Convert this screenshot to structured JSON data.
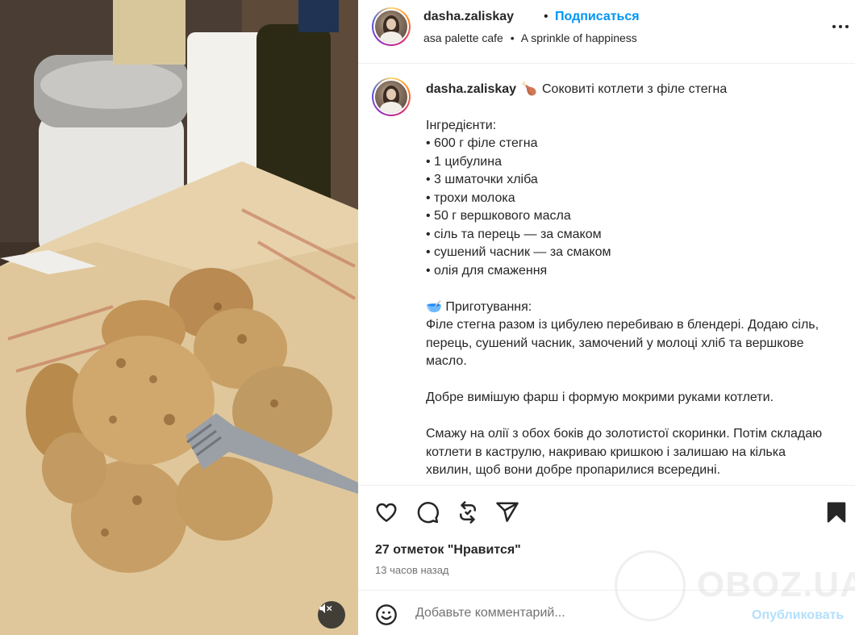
{
  "post": {
    "media": {
      "description_icon": "photo",
      "mute_icon": "speaker-muted-icon"
    },
    "header": {
      "username": "dasha.zaliskay",
      "dot": "•",
      "follow_label": "Подписаться",
      "audio_title": "asa palette cafe",
      "audio_sep": "•",
      "audio_subtitle": "A sprinkle of happiness",
      "more_icon": "more-horizontal-icon"
    },
    "caption": {
      "username": "dasha.zaliskay",
      "title_emoji": "🍗",
      "title": "Соковиті котлети з філе стегна",
      "ingredients_heading": "Інгредієнти:",
      "ingredients": [
        "• 600 г філе стегна",
        "• 1 цибулина",
        "• 3 шматочки хліба",
        "• трохи молока",
        "• 50 г вершкового масла",
        "• сіль та перець — за смаком",
        "• сушений часник — за смаком",
        "• олія для смаження"
      ],
      "method_emoji": "🥣",
      "method_heading": "Приготування:",
      "paragraphs": [
        "Філе стегна разом із цибулею перебиваю в блендері. Додаю сіль, перець, сушений часник, замочений у молоці хліб та вершкове масло.",
        "Добре вимішую фарш і формую мокрими руками котлети.",
        "Смажу на олії з обох боків до золотистої скоринки. Потім складаю котлети в каструлю, накриваю кришкою і залишаю на кілька хвилин, щоб вони добре пропарилися всередині."
      ]
    },
    "actions": {
      "like_icon": "heart-icon",
      "comment_icon": "comment-icon",
      "repost_icon": "repost-icon",
      "share_icon": "send-icon",
      "save_icon": "bookmark-icon"
    },
    "likes_text": "27 отметок \"Нравится\"",
    "time_text": "13 часов назад",
    "comment": {
      "emoji_icon": "smiley-icon",
      "placeholder": "Добавьте комментарий...",
      "publish_label": "Опубликовать"
    }
  },
  "watermark": {
    "text": "OBOZ.UA"
  },
  "colors": {
    "accent": "#0095f6",
    "publish_disabled": "#b2dffc",
    "text": "#262626",
    "muted": "#737373",
    "divider": "#efefef"
  }
}
